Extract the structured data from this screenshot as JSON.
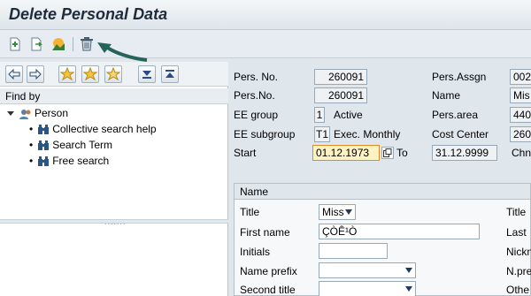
{
  "window": {
    "title": "Delete Personal Data"
  },
  "toolbar": {
    "icons": [
      "create-icon",
      "copy-icon",
      "overview-icon",
      "delete-trash-icon"
    ]
  },
  "nav": {
    "find_by": "Find by",
    "tree": {
      "root": "Person",
      "children": [
        "Collective search help",
        "Search Term",
        "Free search"
      ]
    }
  },
  "header": {
    "pers_no_label": "Pers. No.",
    "pers_no_value": "260091",
    "pers_no2_label": "Pers.No.",
    "pers_no2_value": "260091",
    "pers_assgn_label": "Pers.Assgn",
    "pers_assgn_value": "002",
    "name_label": "Name",
    "name_value": "Mis",
    "ee_group_label": "EE group",
    "ee_group_value": "1",
    "ee_group_text": "Active",
    "pers_area_label": "Pers.area",
    "pers_area_value": "440",
    "ee_subgroup_label": "EE subgroup",
    "ee_subgroup_value": "T1",
    "ee_subgroup_text": "Exec. Monthly",
    "cost_center_label": "Cost Center",
    "cost_center_value": "260",
    "start_label": "Start",
    "start_value": "01.12.1973",
    "to_label": "To",
    "to_value": "31.12.9999",
    "chng_label": "Chn"
  },
  "name_group": {
    "header": "Name",
    "title_label": "Title",
    "title_value": "Miss",
    "title2_label": "Title",
    "first_name_label": "First name",
    "first_name_value": "ÇÒÊ¹Ò",
    "last_label": "Last",
    "initials_label": "Initials",
    "nickn_label": "Nickn",
    "name_prefix_label": "Name prefix",
    "nprefix_label": "N.pre",
    "second_title_label": "Second title",
    "other_label": "Othe"
  }
}
